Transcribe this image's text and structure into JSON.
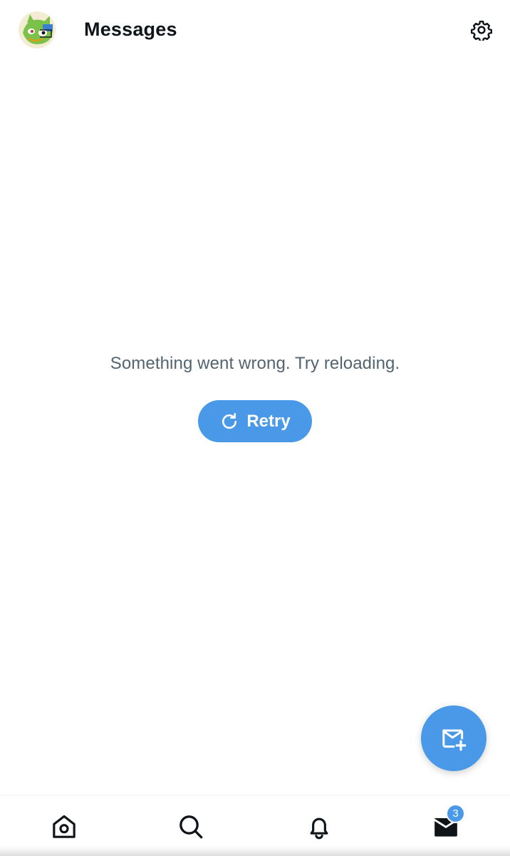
{
  "header": {
    "title": "Messages",
    "avatar_icon": "user-avatar",
    "settings_icon": "gear-icon"
  },
  "error_state": {
    "message": "Something went wrong. Try reloading.",
    "retry_label": "Retry",
    "retry_icon": "refresh-icon"
  },
  "fab": {
    "icon": "new-message-icon"
  },
  "bottom_nav": {
    "items": [
      {
        "name": "home",
        "icon": "home-icon"
      },
      {
        "name": "search",
        "icon": "search-icon"
      },
      {
        "name": "notifications",
        "icon": "bell-icon"
      },
      {
        "name": "messages",
        "icon": "envelope-icon",
        "active": true
      }
    ],
    "messages_badge": "3"
  },
  "colors": {
    "accent": "#4a99e9",
    "text_primary": "#0f1419",
    "text_secondary": "#536471"
  }
}
